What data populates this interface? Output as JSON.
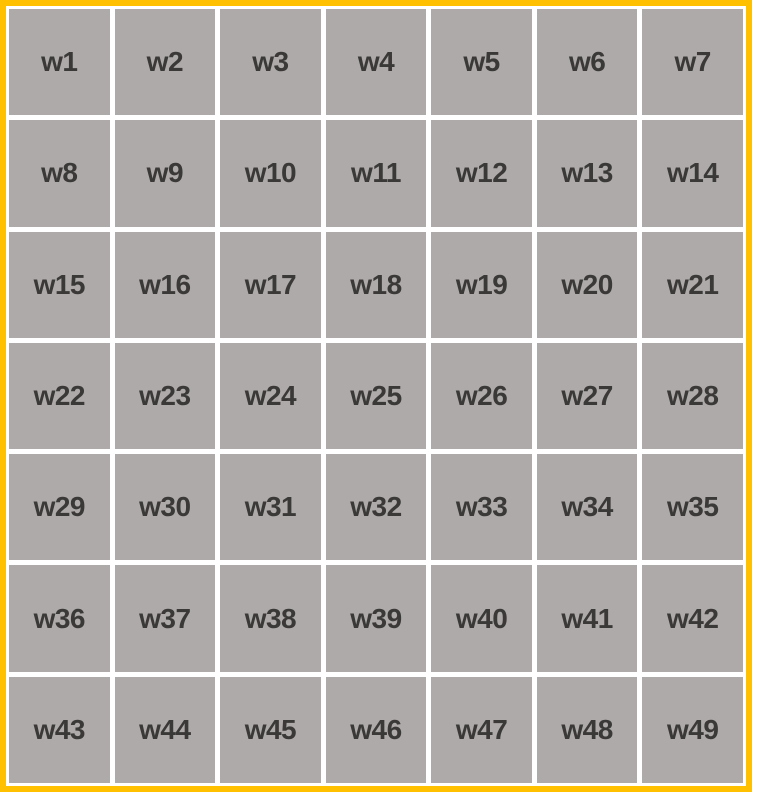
{
  "colors": {
    "frame_border": "#ffc000",
    "cell_fill": "#aeaaaa",
    "gap": "#ffffff",
    "label_text": "#3b3838"
  },
  "grid": {
    "rows": 7,
    "columns": 7,
    "cells": [
      "w1",
      "w2",
      "w3",
      "w4",
      "w5",
      "w6",
      "w7",
      "w8",
      "w9",
      "w10",
      "w11",
      "w12",
      "w13",
      "w14",
      "w15",
      "w16",
      "w17",
      "w18",
      "w19",
      "w20",
      "w21",
      "w22",
      "w23",
      "w24",
      "w25",
      "w26",
      "w27",
      "w28",
      "w29",
      "w30",
      "w31",
      "w32",
      "w33",
      "w34",
      "w35",
      "w36",
      "w37",
      "w38",
      "w39",
      "w40",
      "w41",
      "w42",
      "w43",
      "w44",
      "w45",
      "w46",
      "w47",
      "w48",
      "w49"
    ]
  }
}
